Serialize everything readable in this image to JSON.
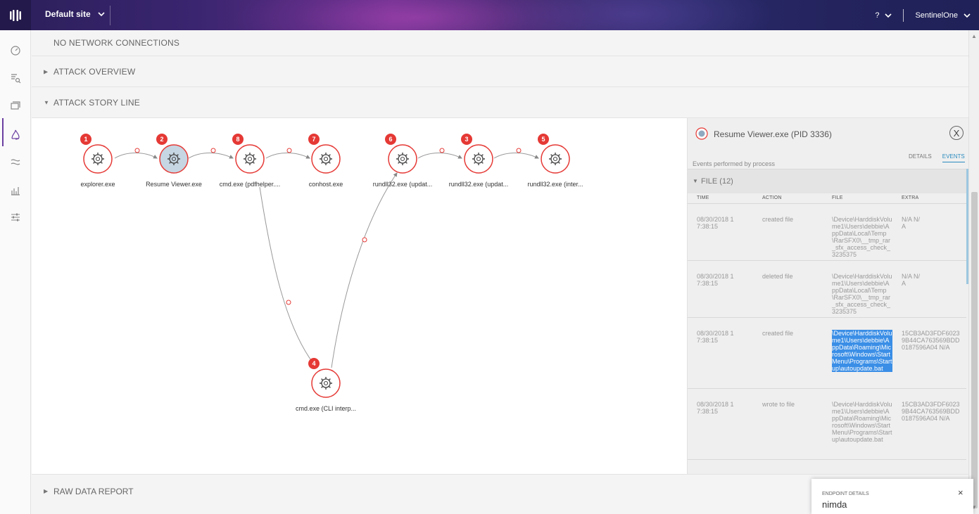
{
  "topbar": {
    "site": "Default site",
    "help": "?",
    "account": "SentinelOne"
  },
  "sidebar": {
    "items": [
      "dashboard-icon",
      "search-icon",
      "endpoints-icon",
      "threats-icon",
      "activity-icon",
      "reports-icon",
      "settings-icon"
    ]
  },
  "sections": {
    "network": "NO NETWORK CONNECTIONS",
    "attack_overview": "ATTACK OVERVIEW",
    "story_line": "ATTACK STORY LINE",
    "raw_data": "RAW DATA REPORT"
  },
  "graph": {
    "nodes": [
      {
        "badge": "1",
        "label": "explorer.exe"
      },
      {
        "badge": "2",
        "label": "Resume Viewer.exe"
      },
      {
        "badge": "8",
        "label": "cmd.exe (pdfhelper...."
      },
      {
        "badge": "7",
        "label": "conhost.exe"
      },
      {
        "badge": "6",
        "label": "rundll32.exe (updat..."
      },
      {
        "badge": "3",
        "label": "rundll32.exe (updat..."
      },
      {
        "badge": "5",
        "label": "rundll32.exe (inter..."
      },
      {
        "badge": "4",
        "label": "cmd.exe (CLI interp..."
      }
    ]
  },
  "panel": {
    "title": "Resume Viewer.exe (PID 3336)",
    "close": "X",
    "tabs": [
      "DETAILS",
      "EVENTS"
    ],
    "subtitle": "Events performed by process",
    "group": "FILE (12)",
    "columns": [
      "TIME",
      "ACTION",
      "FILE",
      "EXTRA"
    ],
    "events": [
      {
        "time": "08/30/2018 17:38:15",
        "action": "created file",
        "file": "\\Device\\HarddiskVolume1\\Users\\debbie\\AppData\\Local\\Temp\\RarSFX0\\__tmp_rar_sfx_access_check_3235375",
        "extra": "N/A N/A"
      },
      {
        "time": "08/30/2018 17:38:15",
        "action": "deleted file",
        "file": "\\Device\\HarddiskVolume1\\Users\\debbie\\AppData\\Local\\Temp\\RarSFX0\\__tmp_rar_sfx_access_check_3235375",
        "extra": "N/A N/A"
      },
      {
        "time": "08/30/2018 17:38:15",
        "action": "created file",
        "file": "\\Device\\HarddiskVolume1\\Users\\debbie\\AppData\\Roaming\\Microsoft\\Windows\\Start Menu\\Programs\\Startup\\autoupdate.bat",
        "extra": "15CB3AD3FDF60239B44CA763569BDD0187596A04 N/A"
      },
      {
        "time": "08/30/2018 17:38:15",
        "action": "wrote to file",
        "file": "\\Device\\HarddiskVolume1\\Users\\debbie\\AppData\\Roaming\\Microsoft\\Windows\\Start Menu\\Programs\\Startup\\autoupdate.bat",
        "extra": "15CB3AD3FDF60239B44CA763569BDD0187596A04 N/A"
      }
    ]
  },
  "endpoint": {
    "title": "ENDPOINT DETAILS",
    "value": "nimda",
    "close": "×"
  },
  "colors": {
    "accent": "#2a8bbf",
    "node_red": "#e53935",
    "selected": "#3a8ee6"
  }
}
